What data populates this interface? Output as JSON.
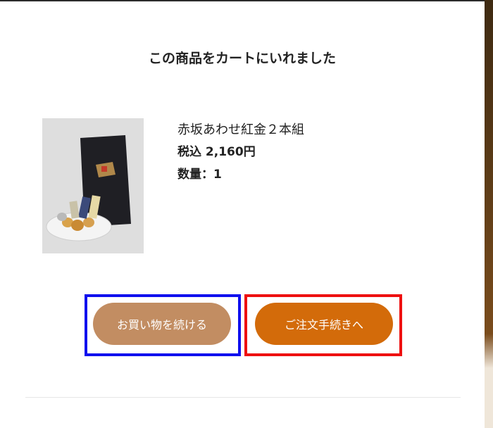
{
  "modal": {
    "title": "この商品をカートにいれました"
  },
  "product": {
    "name": "赤坂あわせ紅金２本組",
    "price": "税込 2,160円",
    "quantity": "数量：1"
  },
  "buttons": {
    "continue_label": "お買い物を続ける",
    "checkout_label": "ご注文手続きへ"
  },
  "colors": {
    "continue_button": "#c28d62",
    "checkout_button": "#d36b0a",
    "highlight_blue": "#1010ee",
    "highlight_red": "#ee1010"
  }
}
